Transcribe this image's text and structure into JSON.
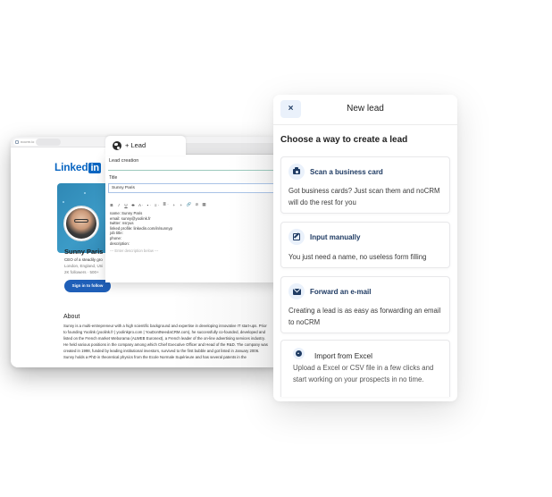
{
  "browser": {
    "url": "nocrm.io"
  },
  "linkedin": {
    "logo_text": "Linked",
    "logo_badge": "in",
    "profile": {
      "name": "Sunny Paris",
      "headline": "CEO of a steadily gro",
      "location": "London, England, Uni",
      "followers": "2K followers  ·  500+",
      "follow_button": "Sign in to follow"
    },
    "about": {
      "title": "About",
      "text": "Sunny is a multi-entrepreneur with a high scientific background and expertise in developing innovative IT start-ups. Prior to founding Yoolink (yoolink.fr | yoolinkpro.com | YouDontNeedaCRM.com), he successfully co-founded, developed and listed on the French market Weborama (ALWEB Euronext), a French leader of the on-line advertising services industry. He held various positions in the company among which Chief Executive Officer and Head of the R&D. The company was created in 1998, funded by leading institutional investors, survived to the first bubble and got listed in January 2006. Sunny holds a PhD in theoretical physics from the Ecole Normale Supérieure and has several patents in the"
    }
  },
  "extension": {
    "tab_label": "+ Lead",
    "section_title": "Lead creation",
    "title_label": "Title",
    "title_value": "Sunny Paris",
    "toolbar": [
      "B",
      "I",
      "U",
      "S",
      "A ·",
      "▪ ·",
      "≡ ·",
      "≣ ·",
      "+",
      "+",
      "🔗",
      "⊘",
      "▦"
    ],
    "content_lines": [
      "name: Sunny Paris",
      "email: sunny@yoolink.fr",
      "twitter: nsryus",
      "linked profile: linkedin.com/in/sunnyp",
      "job title:",
      "phone:",
      "description:"
    ],
    "placeholder": "--- Enter description below ---"
  },
  "modal": {
    "close_label": "×",
    "title": "New lead",
    "subtitle": "Choose a way to create a lead",
    "options": [
      {
        "icon": "camera-icon",
        "title": "Scan a business card",
        "description": "Got business cards? Just scan them and noCRM will do the rest for you"
      },
      {
        "icon": "edit-icon",
        "title": "Input manually",
        "description": "You just need a name, no useless form filling"
      },
      {
        "icon": "envelope-icon",
        "title": "Forward an e-mail",
        "description": "Creating a lead is as easy as forwarding an email to noCRM"
      },
      {
        "icon": "upload-icon",
        "title": "Import from Excel",
        "description": "Upload a Excel or CSV file in a few clicks and start working on your prospects in no time."
      }
    ]
  },
  "colors": {
    "accent": "#1f3b63",
    "icon_bg": "#eaf1fb",
    "linkedin_blue": "#0a66c2",
    "follow_button": "#1f5fb8"
  }
}
